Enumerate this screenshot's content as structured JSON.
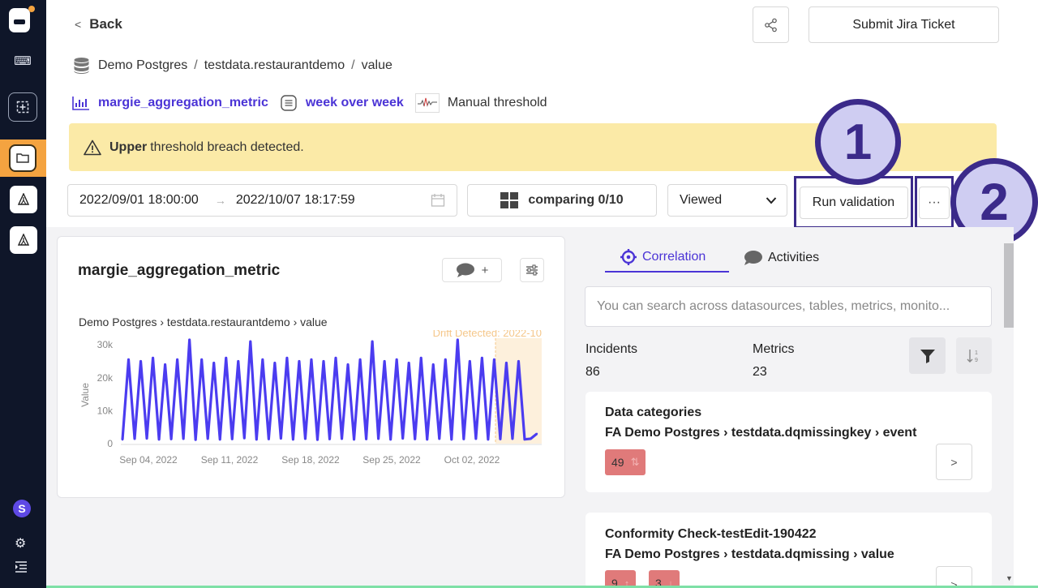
{
  "header": {
    "back_label": "Back",
    "jira_label": "Submit Jira Ticket",
    "breadcrumb": [
      "Demo Postgres",
      "testdata.restaurantdemo",
      "value"
    ],
    "metric_name": "margie_aggregation_metric",
    "aggregation": "week over week",
    "threshold_label": "Manual threshold"
  },
  "alert": {
    "bold": "Upper",
    "text": "threshold breach detected."
  },
  "controls": {
    "date_start": "2022/09/01 18:00:00",
    "date_end": "2022/10/07 18:17:59",
    "arrow": "→",
    "comparing": "comparing 0/10",
    "viewed": "Viewed",
    "run_validation": "Run validation",
    "more": "···",
    "badge_1": "1",
    "badge_2": "2"
  },
  "chart_card": {
    "title": "margie_aggregation_metric",
    "comment_plus": "+",
    "subtitle": "Demo Postgres › testdata.restaurantdemo › value",
    "drift_label": "Drift Detected: 2022-10",
    "ylabel": "Value"
  },
  "chart_data": {
    "type": "line",
    "title": "",
    "xlabel": "",
    "ylabel": "Value",
    "ylim": [
      0,
      32000
    ],
    "yticks": [
      "0",
      "10k",
      "20k",
      "30k"
    ],
    "xticks": [
      "Sep 04, 2022",
      "Sep 11, 2022",
      "Sep 18, 2022",
      "Sep 25, 2022",
      "Oct 02, 2022"
    ],
    "series": [
      {
        "values": [
          1200,
          25500,
          1500,
          25000,
          1600,
          26000,
          1300,
          24000,
          1400,
          25500,
          1500,
          31500,
          1200,
          25500,
          1500,
          24500,
          1300,
          26000,
          1400,
          25000,
          1700,
          31000,
          1300,
          25500,
          1400,
          24500,
          1600,
          26000,
          1300,
          25000,
          1500,
          25500,
          1200,
          25000,
          1400,
          26000,
          1500,
          24000,
          1300,
          25500,
          1400,
          31000,
          1500,
          25000,
          1300,
          25500,
          1600,
          24500,
          1400,
          26000,
          1300,
          24000,
          1500,
          25500,
          1300,
          31500,
          1400,
          25000,
          1500,
          26000,
          1300,
          25500,
          1400,
          24500,
          1500,
          25000,
          1300,
          1500,
          3000
        ]
      }
    ],
    "color": "#4b3cf0"
  },
  "tabs": {
    "correlation": "Correlation",
    "activities": "Activities"
  },
  "search": {
    "placeholder": "You can search across datasources, tables, metrics, monito..."
  },
  "stats": {
    "incidents_label": "Incidents",
    "incidents_value": "86",
    "metrics_label": "Metrics",
    "metrics_value": "23"
  },
  "incidents": [
    {
      "title": "Data categories",
      "path": "FA Demo Postgres › testdata.dqmissingkey › event",
      "tags": [
        "49"
      ]
    },
    {
      "title": "Conformity Check-testEdit-190422",
      "path": "FA Demo Postgres › testdata.dqmissing › value",
      "tags": [
        "9",
        "3"
      ]
    }
  ],
  "colors": {
    "accent": "#4b34d6",
    "alert_bg": "#fbeaa7",
    "rail_bg": "#0f1629",
    "rail_active": "#f4a340",
    "tag_bg": "#e07a7a",
    "badge_border": "#3b2a8a"
  }
}
